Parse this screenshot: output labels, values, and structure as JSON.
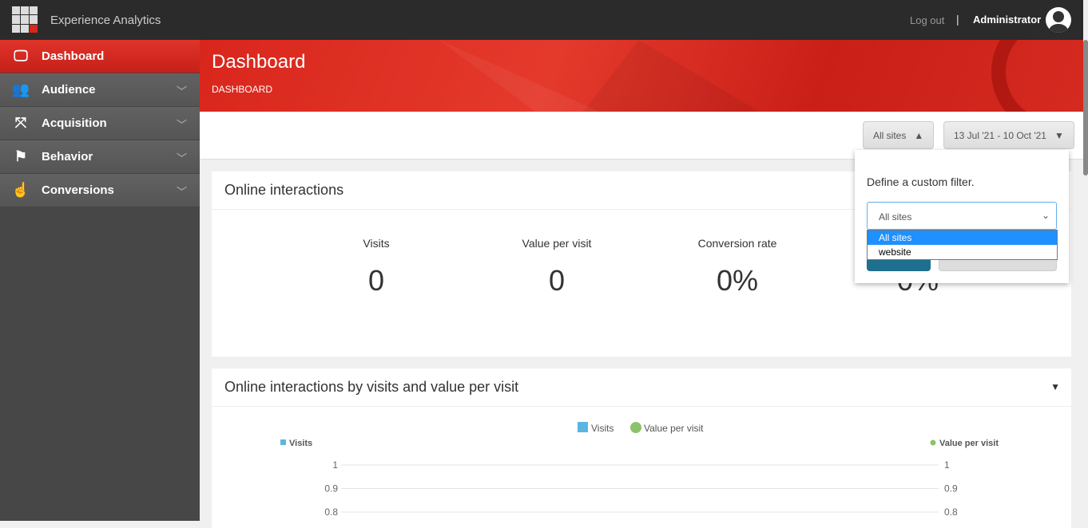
{
  "header": {
    "app_title": "Experience Analytics",
    "logout": "Log out",
    "separator": "|",
    "user": "Administrator"
  },
  "sidebar": {
    "items": [
      {
        "label": "Dashboard",
        "icon": "presentation-icon",
        "glyph": "🖵",
        "active": true
      },
      {
        "label": "Audience",
        "icon": "people-icon",
        "glyph": "👥"
      },
      {
        "label": "Acquisition",
        "icon": "arrows-in-icon",
        "glyph": "⤧"
      },
      {
        "label": "Behavior",
        "icon": "signpost-icon",
        "glyph": "⚑"
      },
      {
        "label": "Conversions",
        "icon": "touch-icon",
        "glyph": "☝"
      }
    ]
  },
  "banner": {
    "title": "Dashboard",
    "breadcrumb": "DASHBOARD"
  },
  "filters": {
    "sites": "All sites",
    "date_range": "13 Jul '21 - 10 Oct '21"
  },
  "popup": {
    "text": "Define a custom filter.",
    "selected": "All sites",
    "options": [
      "All sites",
      "website"
    ]
  },
  "panel1": {
    "title": "Online interactions",
    "metrics": [
      {
        "label": "Visits",
        "value": "0"
      },
      {
        "label": "Value per visit",
        "value": "0"
      },
      {
        "label": "Conversion rate",
        "value": "0%"
      },
      {
        "label": "",
        "value": "0%"
      }
    ]
  },
  "panel2": {
    "title": "Online interactions by visits and value per visit"
  },
  "chart_data": {
    "type": "line",
    "legend": [
      {
        "name": "Visits",
        "color": "#5bb5e0"
      },
      {
        "name": "Value per visit",
        "color": "#8bc36a"
      }
    ],
    "y_left": {
      "label": "Visits",
      "ticks": [
        "1",
        "0.9",
        "0.8"
      ]
    },
    "y_right": {
      "label": "Value per visit",
      "ticks": [
        "1",
        "0.9",
        "0.8"
      ]
    },
    "grid": true,
    "legend_position": "top"
  }
}
